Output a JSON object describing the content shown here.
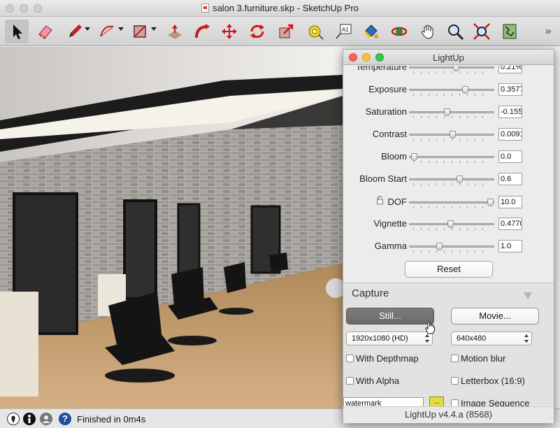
{
  "window": {
    "title": "salon 3.furniture.skp - SketchUp Pro"
  },
  "toolbar": {
    "tools": [
      "select-icon",
      "eraser-icon",
      "pencil-icon",
      "arc-icon",
      "rectangle-icon",
      "push-pull-icon",
      "follow-me-icon",
      "move-icon",
      "rotate-icon",
      "scale-icon",
      "tape-measure-icon",
      "text-icon",
      "paint-bucket-icon",
      "orbit-icon",
      "pan-icon",
      "zoom-icon",
      "zoom-extents-icon",
      "map-icon"
    ],
    "more": "»"
  },
  "status": {
    "text": "Finished in 0m4s"
  },
  "panel": {
    "title": "LightUp",
    "rows": [
      {
        "label": "Temperature",
        "value": "0.21%",
        "pos": 0.55
      },
      {
        "label": "Exposure",
        "value": "0.3577",
        "pos": 0.66
      },
      {
        "label": "Saturation",
        "value": "-0.155",
        "pos": 0.44
      },
      {
        "label": "Contrast",
        "value": "0.0091",
        "pos": 0.51
      },
      {
        "label": "Bloom",
        "value": "0.0",
        "pos": 0.05
      },
      {
        "label": "Bloom Start",
        "value": "0.6",
        "pos": 0.59
      },
      {
        "label": "DOF",
        "value": "10.0",
        "pos": 0.96
      },
      {
        "label": "Vignette",
        "value": "0.4770",
        "pos": 0.48
      },
      {
        "label": "Gamma",
        "value": "1.0",
        "pos": 0.35
      }
    ],
    "reset": "Reset",
    "capture": {
      "title": "Capture",
      "still": "Still...",
      "movie": "Movie...",
      "resolution": "1920x1080 (HD)",
      "movie_resolution": "640x480",
      "depthmap": "With Depthmap",
      "motion_blur": "Motion blur",
      "alpha": "With Alpha",
      "letterbox": "Letterbox (16:9)",
      "watermark": "watermark",
      "swatch_label": "...",
      "image_sequence": "Image Sequence"
    },
    "version": "LightUp v4.4.a (8568)"
  },
  "colors": {
    "accent_yellow": "#e4dc3a",
    "close": "#fc605b",
    "minimize": "#fdbc40",
    "zoom": "#34c84a"
  }
}
